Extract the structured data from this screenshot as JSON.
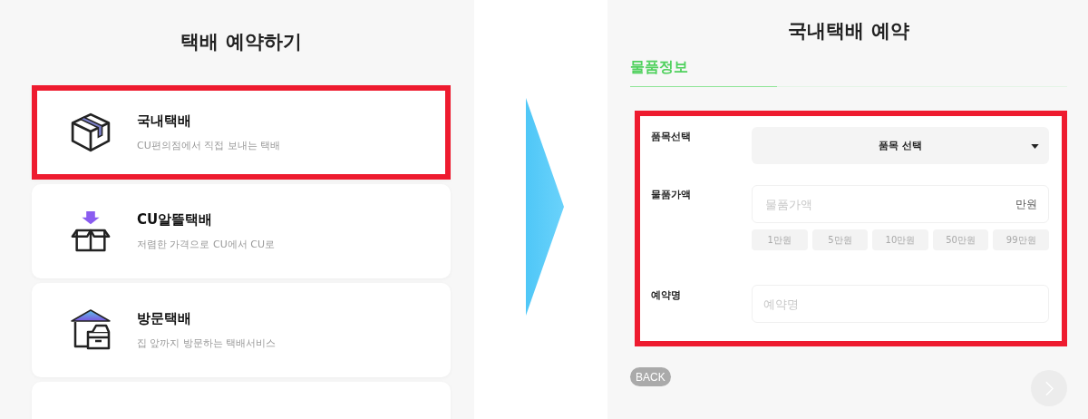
{
  "left": {
    "title": "택배 예약하기",
    "services": [
      {
        "kind": "box",
        "title": "국내택배",
        "subtitle": "CU편의점에서 직접 보내는 택배",
        "highlighted": true
      },
      {
        "kind": "arrow_box",
        "title": "CU알뜰택배",
        "subtitle": "저렴한 가격으로 CU에서 CU로",
        "highlighted": false
      },
      {
        "kind": "house",
        "title": "방문택배",
        "subtitle": "집 앞까지 방문하는 택배서비스",
        "highlighted": false
      },
      {
        "kind": "cut_off",
        "highlighted": false
      }
    ]
  },
  "right": {
    "title": "국내택배 예약",
    "tabs": [
      {
        "label": "물품정보",
        "selected": true
      }
    ],
    "form": {
      "highlighted": true,
      "item": {
        "label": "품목선택",
        "value": "품목 선택"
      },
      "price": {
        "label": "물품가액",
        "placeholder": "물품가액",
        "unit": "만원",
        "chips": [
          {
            "label": "1만원",
            "disabled": true
          },
          {
            "label": "5만원",
            "disabled": true
          },
          {
            "label": "10만원",
            "disabled": true
          },
          {
            "label": "50만원",
            "disabled": true
          },
          {
            "label": "99만원",
            "disabled": true
          }
        ]
      },
      "name": {
        "label": "예약명",
        "placeholder": "예약명"
      }
    },
    "back": {
      "label": "BACK"
    },
    "next": {
      "disabled": true
    }
  }
}
